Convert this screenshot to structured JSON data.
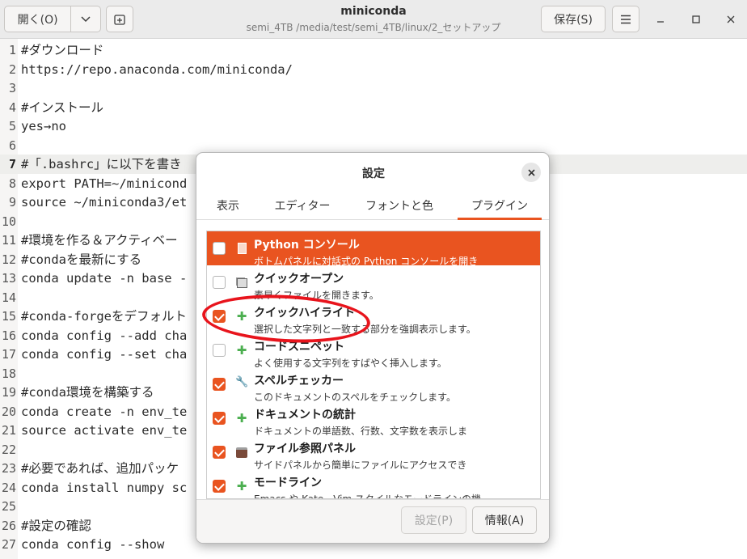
{
  "window": {
    "title": "miniconda",
    "subtitle": "semi_4TB /media/test/semi_4TB/linux/2_セットアップ"
  },
  "header": {
    "open_label": "開く(O)",
    "save_label": "保存(S)"
  },
  "editor": {
    "lines": [
      {
        "n": "1",
        "text": "#ダウンロード"
      },
      {
        "n": "2",
        "text": "https://repo.anaconda.com/miniconda/"
      },
      {
        "n": "3",
        "text": ""
      },
      {
        "n": "4",
        "text": "#インストール"
      },
      {
        "n": "5",
        "text": "yes→no"
      },
      {
        "n": "6",
        "text": ""
      },
      {
        "n": "7",
        "text": "#「.bashrc」に以下を書き"
      },
      {
        "n": "8",
        "text": "export PATH=~/minicond"
      },
      {
        "n": "9",
        "text": "source ~/miniconda3/et"
      },
      {
        "n": "10",
        "text": ""
      },
      {
        "n": "11",
        "text": "#環境を作る＆アクティベー"
      },
      {
        "n": "12",
        "text": "#condaを最新にする"
      },
      {
        "n": "13",
        "text": "conda update -n base -"
      },
      {
        "n": "14",
        "text": ""
      },
      {
        "n": "15",
        "text": "#conda-forgeをデフォルト"
      },
      {
        "n": "16",
        "text": "conda config --add cha"
      },
      {
        "n": "17",
        "text": "conda config --set cha"
      },
      {
        "n": "18",
        "text": ""
      },
      {
        "n": "19",
        "text": "#conda環境を構築する"
      },
      {
        "n": "20",
        "text": "conda create -n env_te"
      },
      {
        "n": "21",
        "text": "source activate env_te"
      },
      {
        "n": "22",
        "text": ""
      },
      {
        "n": "23",
        "text": "#必要であれば、追加パッケ"
      },
      {
        "n": "24",
        "text": "conda install numpy sc"
      },
      {
        "n": "25",
        "text": ""
      },
      {
        "n": "26",
        "text": "#設定の確認"
      },
      {
        "n": "27",
        "text": "conda config --show"
      }
    ]
  },
  "dialog": {
    "title": "設定",
    "tabs": [
      "表示",
      "エディター",
      "フォントと色",
      "プラグイン"
    ],
    "plugins": [
      {
        "name": "Python コンソール",
        "desc": "ボトムパネルに対話式の Python コンソールを開き",
        "checked": false,
        "icon": "document-icon",
        "selected": true
      },
      {
        "name": "クイックオープン",
        "desc": "素早くファイルを開きます。",
        "checked": false,
        "icon": "stack-icon",
        "selected": false
      },
      {
        "name": "クイックハイライト",
        "desc": "選択した文字列と一致する部分を強調表示します。",
        "checked": true,
        "icon": "puzzle-icon",
        "selected": false
      },
      {
        "name": "コードスニペット",
        "desc": "よく使用する文字列をすばやく挿入します。",
        "checked": false,
        "icon": "puzzle-icon",
        "selected": false
      },
      {
        "name": "スペルチェッカー",
        "desc": "このドキュメントのスペルをチェックします。",
        "checked": true,
        "icon": "wrench-icon",
        "selected": false
      },
      {
        "name": "ドキュメントの統計",
        "desc": "ドキュメントの単語数、行数、文字数を表示しま",
        "checked": true,
        "icon": "puzzle-icon",
        "selected": false
      },
      {
        "name": "ファイル参照パネル",
        "desc": "サイドパネルから簡単にファイルにアクセスでき",
        "checked": true,
        "icon": "book-icon",
        "selected": false
      },
      {
        "name": "モードライン",
        "desc": "Emacs や Kate、Vim スタイルなモードラインの機",
        "checked": true,
        "icon": "puzzle-icon",
        "selected": false
      }
    ],
    "settings_button": "設定(P)",
    "info_button": "情報(A)"
  },
  "colors": {
    "accent": "#e95420",
    "annotation": "#e8141c"
  }
}
